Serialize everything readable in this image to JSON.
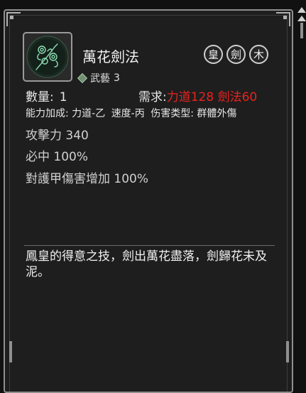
{
  "item": {
    "name": "萬花劍法",
    "category_label": "武藝",
    "category_level": "3",
    "badges": [
      "皇",
      "劍",
      "木"
    ],
    "quantity_label": "數量:",
    "quantity_value": "1",
    "requirement_label": "需求:",
    "requirement_value": "力道128 劍法60",
    "attributes": {
      "bonus_label": "能力加成:",
      "bonus_strength": "力道-乙",
      "bonus_speed": "速度-丙",
      "damage_type_label": "伤害类型:",
      "damage_type_value": "群體外傷"
    },
    "stats": [
      "攻擊力 340",
      "必中 100%",
      "對護甲傷害增加 100%"
    ],
    "description": "鳳皇的得意之技，劍出萬花盡落，劍歸花未及泥。"
  },
  "colors": {
    "requirement": "#e8231f",
    "icon_glow": "#7fd6a8",
    "panel_border": "#8f8f8f"
  },
  "icons": {
    "item_icon": "flower-sword-icon",
    "category_icon": "diamond-icon"
  }
}
